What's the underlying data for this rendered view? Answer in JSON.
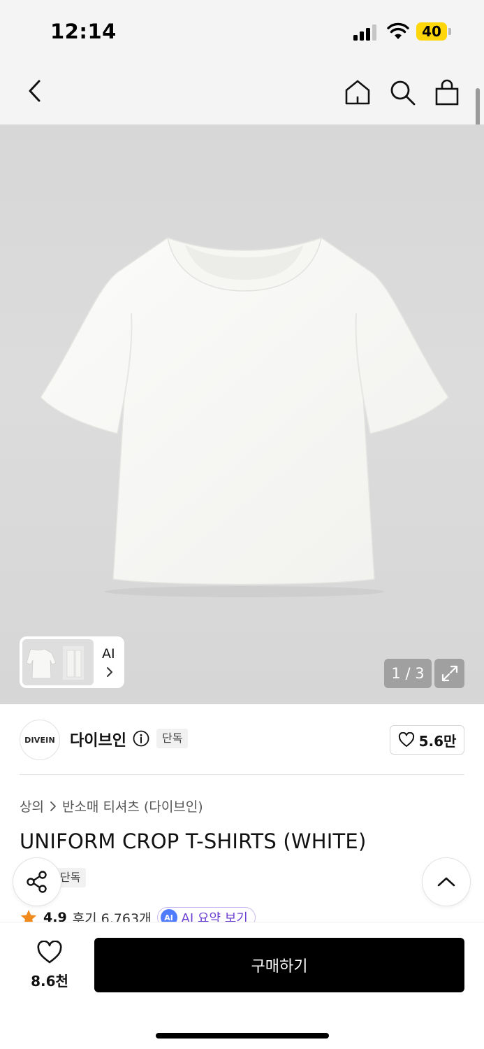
{
  "status_bar": {
    "time": "12:14",
    "battery_level": "40",
    "battery_color": "#ffd60a"
  },
  "nav": {
    "icons": [
      "back-icon",
      "home-icon",
      "search-icon",
      "bag-icon"
    ]
  },
  "gallery": {
    "ai_label": "AI",
    "page_counter": "1 / 3",
    "current_page": 1,
    "total_pages": 3
  },
  "brand": {
    "logo_text": "DIVEIN",
    "name": "다이브인",
    "badge": "단독",
    "like_count": "5.6만"
  },
  "product": {
    "breadcrumb": [
      "상의",
      "반소매 티셔츠 (다이브인)"
    ],
    "title": "UNIFORM CROP T-SHIRTS (WHITE)",
    "badge": "단독",
    "rating": "4.9",
    "review_text": "후기 6,763개",
    "ai_badge": "AI",
    "ai_summary_label": "AI 요약 보기"
  },
  "bottom_bar": {
    "wish_count": "8.6천",
    "buy_label": "구매하기"
  },
  "colors": {
    "accent_star": "#f08a1c",
    "ai_purple": "#6b3fd1",
    "buy_button": "#000000"
  }
}
